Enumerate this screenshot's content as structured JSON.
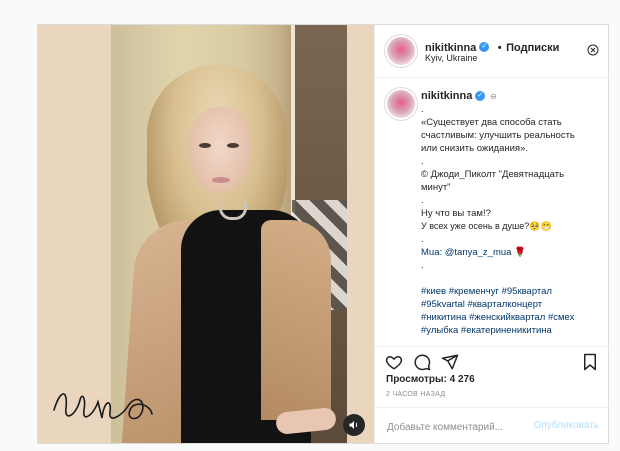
{
  "post": {
    "media": {
      "signature_text": "signature",
      "sound_icon": "volume-icon"
    },
    "header": {
      "username": "nikitkinna",
      "separator": "•",
      "follow_label": "Подписки",
      "location": "Kyiv, Ukraine",
      "more_icon": "more-options-icon"
    },
    "caption": {
      "username": "nikitkinna",
      "lines": [
        ".",
        "«Существует два способа стать",
        "счастливым: улучшить реальность",
        "или снизить ожидания».",
        ".",
        "© Джоди_Пиколт \"Девятнадцать",
        "минут\"",
        ".",
        "Ну что вы там!?",
        "У всех уже осень в душе?🥺😁",
        ".",
        "Mua: @tanya_z_mua 🌹",
        ".",
        "",
        "#киев #кременчуг #95квартал",
        "#95kvartal #кварталконцерт",
        "#никитина #женскийквартал #смех",
        "#улыбка #екатериненикитина"
      ]
    },
    "actions": {
      "like_icon": "heart-icon",
      "comment_icon": "comment-icon",
      "share_icon": "share-icon",
      "save_icon": "bookmark-icon"
    },
    "views_text": "Просмотры: 4 276",
    "time_ago": "2 ЧАСОВ НАЗАД",
    "comment_input": {
      "placeholder": "Добавьте комментарий...",
      "value": ""
    },
    "publish_label": "Опубликовать"
  },
  "colors": {
    "accent": "#3897f0",
    "link": "#00376b",
    "publish_disabled": "#b2dffc",
    "border": "#dbdbdb"
  }
}
